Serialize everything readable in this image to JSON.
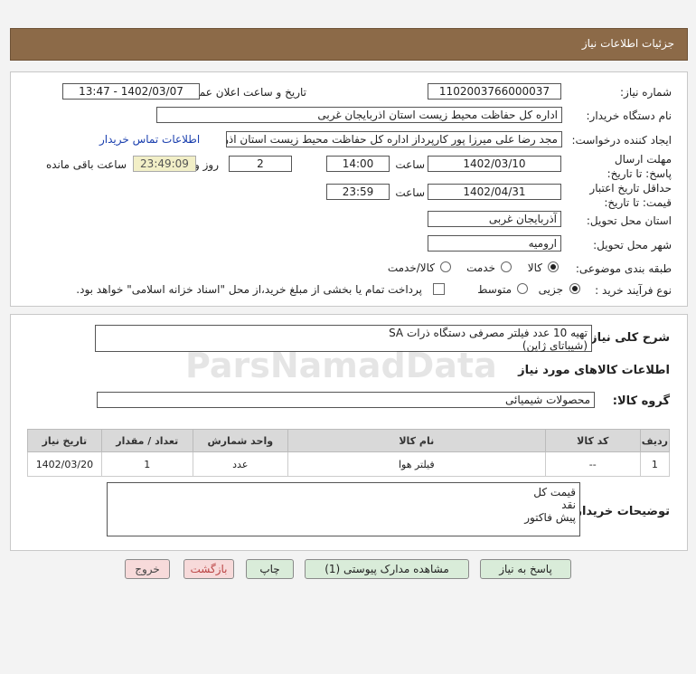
{
  "header": {
    "title": "جزئیات اطلاعات نیاز"
  },
  "form": {
    "need_number_label": "شماره نیاز:",
    "need_number": "1102003766000037",
    "announce_label": "تاریخ و ساعت اعلان عمومی:",
    "announce_value": "1402/03/07 - 13:47",
    "buyer_org_label": "نام دستگاه خریدار:",
    "buyer_org": "اداره کل حفاظت محیط زیست استان اذربایجان غربی",
    "creator_label": "ایجاد کننده درخواست:",
    "creator": "مجد رضا علی میرزا پور کارپرداز اداره کل حفاظت محیط زیست استان اذربایجان غربی",
    "contact_link": "اطلاعات تماس خریدار",
    "reply_deadline_label": "مهلت ارسال پاسخ: تا تاریخ:",
    "reply_date": "1402/03/10",
    "time_label": "ساعت",
    "reply_time": "14:00",
    "days_value": "2",
    "days_label": "روز و",
    "remaining_time": "23:49:09",
    "remaining_label": "ساعت باقی مانده",
    "validity_label": "حداقل تاریخ اعتبار قیمت: تا تاریخ:",
    "validity_date": "1402/04/31",
    "validity_time_label": "ساعت",
    "validity_time": "23:59",
    "province_label": "استان محل تحویل:",
    "province": "آذربایجان غربی",
    "city_label": "شهر محل تحویل:",
    "city": "ارومیه",
    "category_label": "طبقه بندی موضوعی:",
    "category_options": [
      "کالا",
      "خدمت",
      "کالا/خدمت"
    ],
    "process_label": "نوع فرآیند خرید :",
    "process_options": [
      "جزیی",
      "متوسط"
    ],
    "payment_note": "پرداخت تمام یا بخشی از مبلغ خرید،از محل \"اسناد خزانه اسلامی\" خواهد بود."
  },
  "details": {
    "summary_label": "شرح کلی نیاز:",
    "summary_line1": "تهیه 10 عدد فیلتر مصرفی دستگاه ذرات SA",
    "summary_line2": "(شیباتای ژاپن)",
    "goods_info_title": "اطلاعات کالاهای مورد نیاز",
    "goods_group_label": "گروه کالا:",
    "goods_group": "محصولات شیمیائی",
    "table": {
      "headers": [
        "ردیف",
        "کد کالا",
        "نام کالا",
        "واحد شمارش",
        "تعداد / مقدار",
        "تاریخ نیاز"
      ],
      "rows": [
        [
          "1",
          "--",
          "فیلتر هوا",
          "عدد",
          "1",
          "1402/03/20"
        ]
      ]
    },
    "buyer_notes_label": "توضیحات خریدار:",
    "buyer_notes": [
      "قیمت کل",
      "نقد",
      "پیش فاکتور"
    ]
  },
  "buttons": {
    "reply": "پاسخ به نیاز",
    "attachments": "مشاهده مدارک پیوستی (1)",
    "print": "چاپ",
    "back": "بازگشت",
    "exit": "خروج"
  },
  "watermark": {
    "brand": "ParsNamadData"
  }
}
